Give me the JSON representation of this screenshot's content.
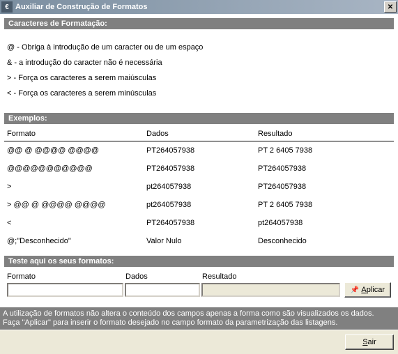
{
  "titlebar": {
    "icon_glyph": "€",
    "title": "Auxiliar de Construção de Formatos",
    "close_glyph": "✕"
  },
  "sections": {
    "chars_header": "Caracteres de Formatação:",
    "examples_header": "Exemplos:",
    "test_header": "Teste aqui os seus formatos:"
  },
  "chars": [
    "@ - Obriga à introdução de um caracter ou de um espaço",
    "& - a introdução do caracter não é necessária",
    "> - Força os caracteres a serem maiúsculas",
    "< - Força os caracteres a serem minúsculas"
  ],
  "examples": {
    "headers": {
      "formato": "Formato",
      "dados": "Dados",
      "resultado": "Resultado"
    },
    "rows": [
      {
        "formato": "@@ @ @@@@ @@@@",
        "dados": "PT264057938",
        "resultado": "PT 2 6405 7938"
      },
      {
        "formato": "@@@@@@@@@@@",
        "dados": "PT264057938",
        "resultado": "PT264057938"
      },
      {
        "formato": ">",
        "dados": "pt264057938",
        "resultado": "PT264057938"
      },
      {
        "formato": "> @@ @ @@@@ @@@@",
        "dados": "pt264057938",
        "resultado": "PT 2 6405 7938"
      },
      {
        "formato": "<",
        "dados": "PT264057938",
        "resultado": "pt264057938"
      },
      {
        "formato": "@;\"Desconhecido\"",
        "dados": "Valor Nulo",
        "resultado": "Desconhecido"
      }
    ]
  },
  "test": {
    "labels": {
      "formato": "Formato",
      "dados": "Dados",
      "resultado": "Resultado"
    },
    "values": {
      "formato": "",
      "dados": "",
      "resultado": ""
    },
    "apply_icon": "📌",
    "apply_label": "Aplicar"
  },
  "footer": {
    "line1": "A utilização de formatos não altera o conteúdo dos campos apenas a forma como são visualizados os dados.",
    "line2": "Faça \"Aplicar\" para inserir o formato desejado no campo formato da parametrização das listagens."
  },
  "buttons": {
    "exit": "Sair"
  }
}
